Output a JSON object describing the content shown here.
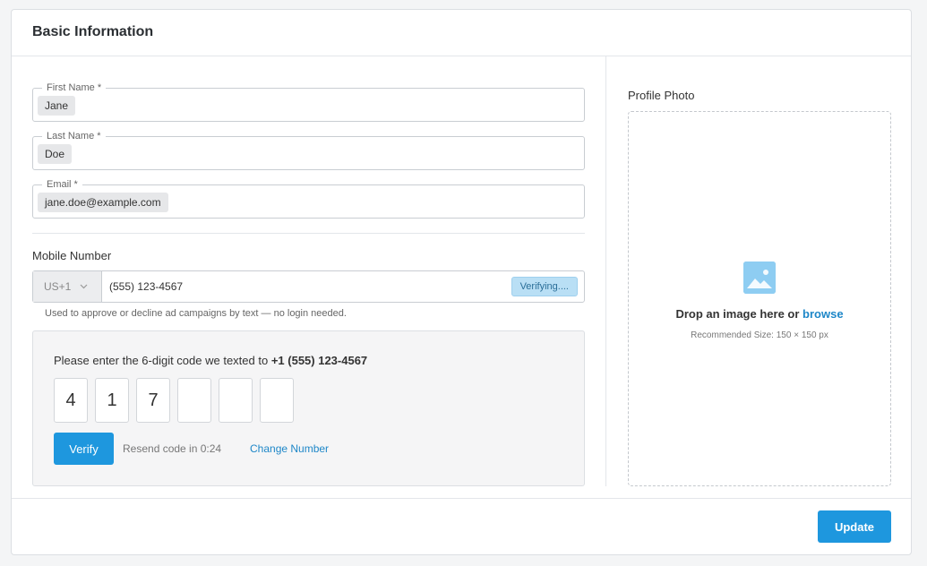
{
  "header": {
    "title": "Basic Information"
  },
  "fields": {
    "first_name": {
      "label": "First Name *",
      "value": "Jane"
    },
    "last_name": {
      "label": "Last Name *",
      "value": "Doe"
    },
    "email": {
      "label": "Email *",
      "value": "jane.doe@example.com"
    }
  },
  "mobile": {
    "label": "Mobile Number",
    "country_code": "US+1",
    "value": "(555) 123-4567",
    "status": "Verifying....",
    "hint": "Used to approve or decline ad campaigns by text — no login needed."
  },
  "otp": {
    "prompt_prefix": "Please enter the 6-digit code we texted to ",
    "prompt_number": "+1 (555) 123-4567",
    "digits": [
      "4",
      "1",
      "7",
      "",
      "",
      ""
    ],
    "verify_label": "Verify",
    "resend_text": "Resend code in 0:24",
    "change_label": "Change Number"
  },
  "photo": {
    "label": "Profile Photo",
    "drop_text": "Drop an image here or ",
    "browse_label": "browse",
    "recommended": "Recommended Size: 150 × 150 px",
    "icon": "image-icon"
  },
  "footer": {
    "update_label": "Update"
  },
  "colors": {
    "accent": "#1e97de",
    "link": "#1e87c8",
    "verifying_bg": "#b9dff5"
  }
}
